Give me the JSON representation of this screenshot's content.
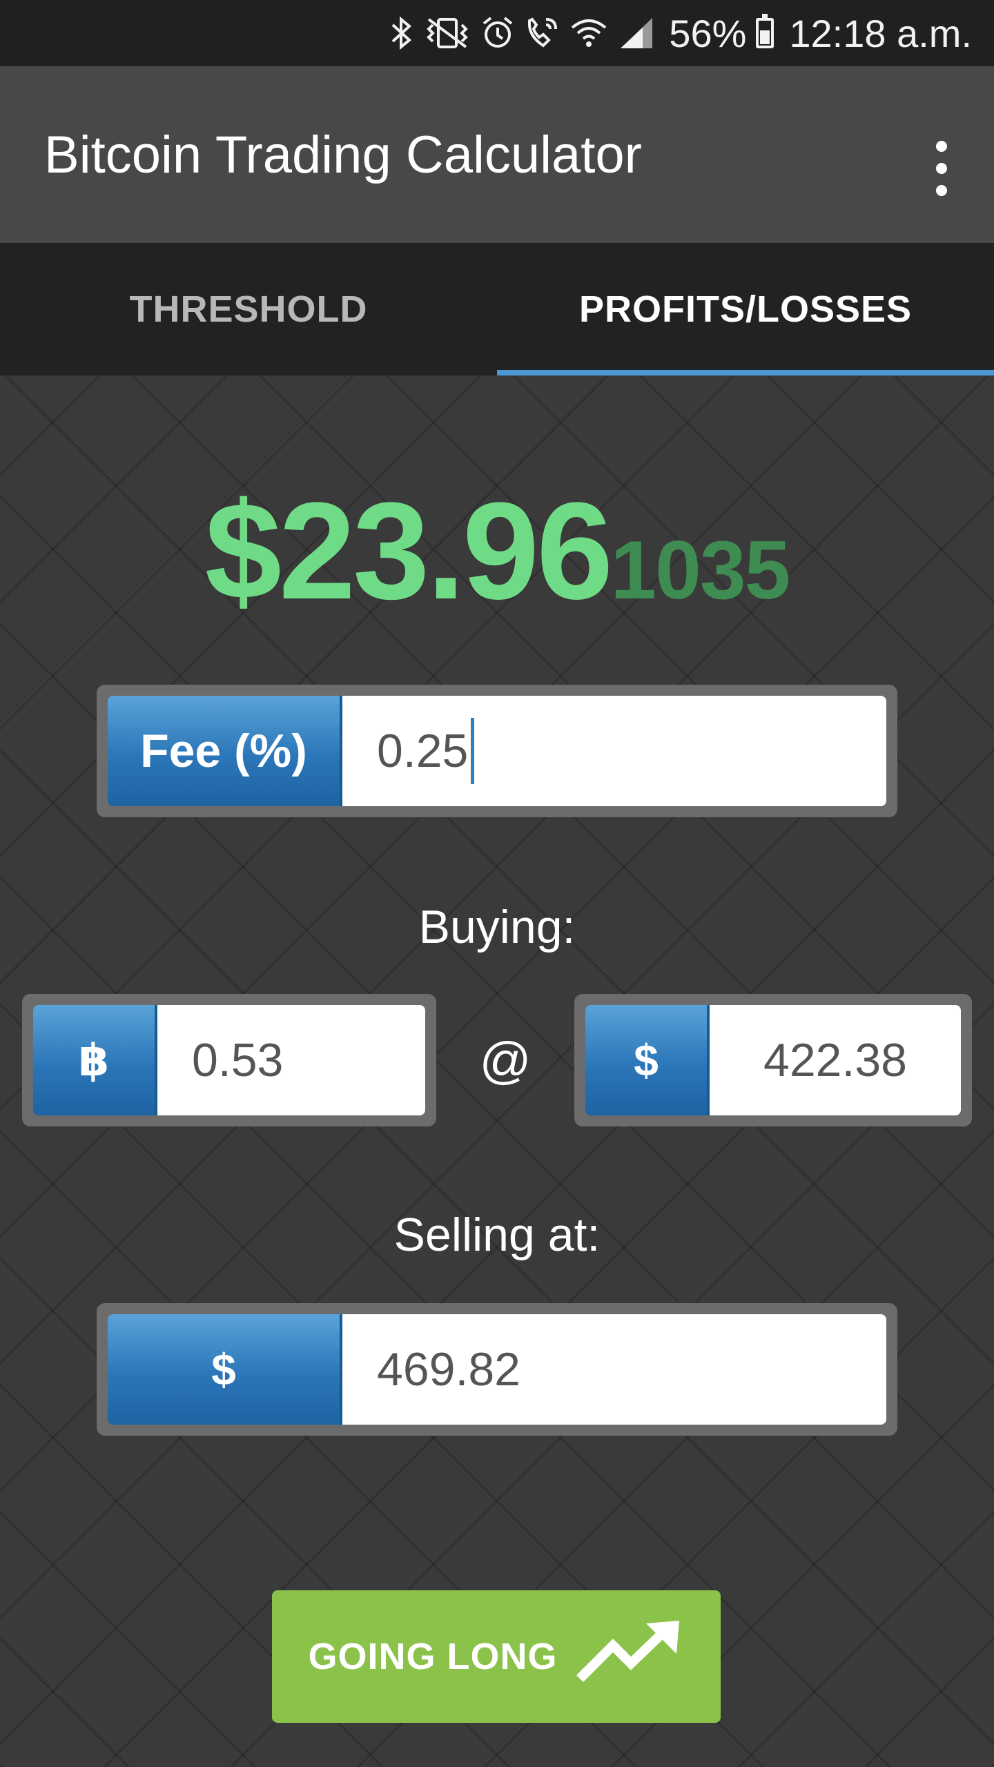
{
  "status_bar": {
    "battery_percent": "56%",
    "time": "12:18 a.m.",
    "icons": [
      "bluetooth-icon",
      "vibrate-icon",
      "alarm-icon",
      "wifi-call-icon",
      "wifi-icon",
      "signal-icon",
      "battery-icon"
    ]
  },
  "app_bar": {
    "title": "Bitcoin Trading Calculator",
    "menu_icon": "overflow-menu-icon"
  },
  "tabs": [
    {
      "label": "THRESHOLD",
      "active": false
    },
    {
      "label": "PROFITS/LOSSES",
      "active": true
    }
  ],
  "result": {
    "main": "$23.96",
    "extra_digits": "1035",
    "color_main": "#6fdb86",
    "color_extra": "#3f8c52"
  },
  "fee": {
    "label": "Fee (%)",
    "value": "0.25"
  },
  "buying": {
    "label": "Buying:",
    "btc_symbol": "฿",
    "btc_amount": "0.53",
    "at": "@",
    "price_symbol": "$",
    "price": "422.38"
  },
  "selling": {
    "label": "Selling at:",
    "symbol": "$",
    "price": "469.82"
  },
  "action_button": {
    "label": "GOING LONG",
    "icon": "trending-up-icon",
    "color": "#8bc34a"
  },
  "colors": {
    "accent_blue": "#4d97d2",
    "tab_bar": "#222222",
    "app_bar": "#484848"
  }
}
